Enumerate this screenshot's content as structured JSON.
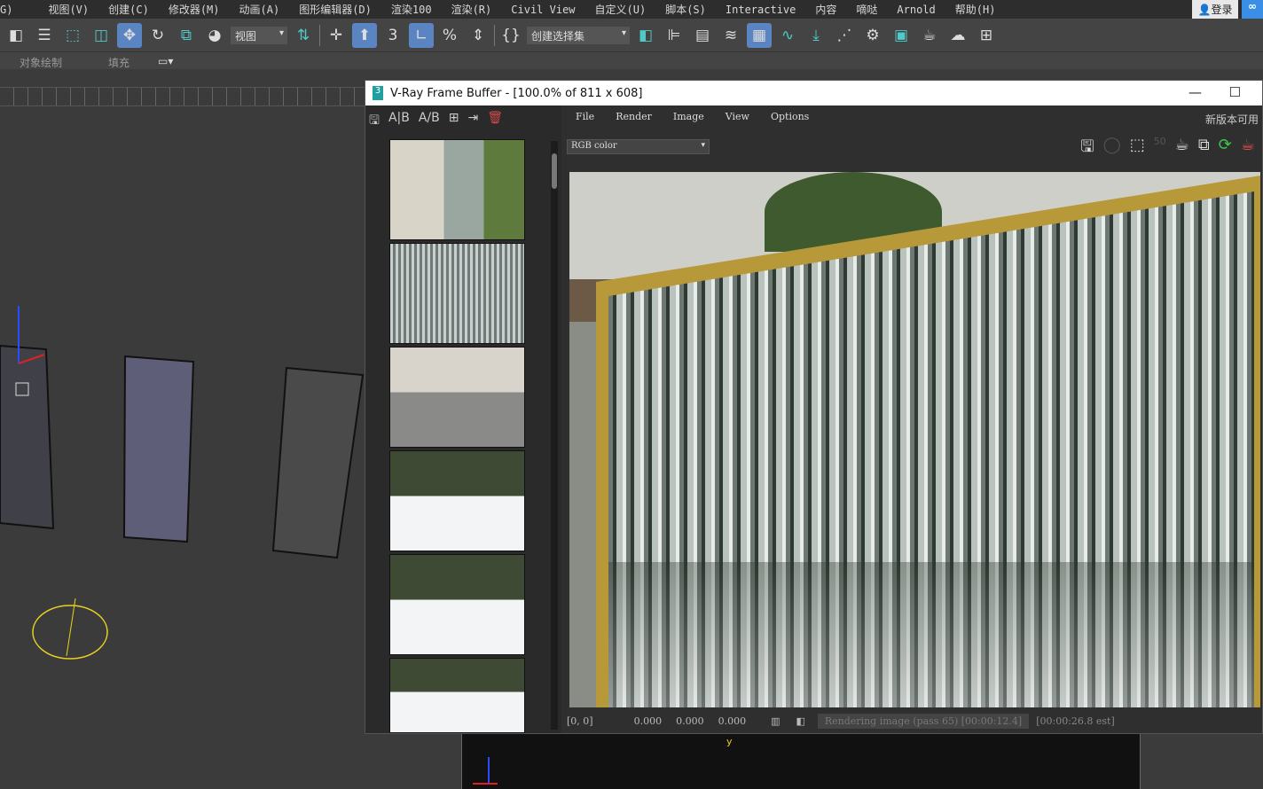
{
  "menu": {
    "items": [
      "G)",
      "视图(V)",
      "创建(C)",
      "修改器(M)",
      "动画(A)",
      "图形编辑器(D)",
      "渲染100",
      "渲染(R)",
      "Civil View",
      "自定义(U)",
      "脚本(S)",
      "Interactive",
      "内容",
      "嘀哒",
      "Arnold",
      "帮助(H)"
    ],
    "login": "登录"
  },
  "toolbar": {
    "view_dropdown": "视图",
    "selection_set": "创建选择集"
  },
  "ribbon": {
    "tab1": "对象绘制",
    "tab2": "填充"
  },
  "vfb": {
    "title": "V-Ray Frame Buffer - [100.0% of 811 x 608]",
    "menu": [
      "File",
      "Render",
      "Image",
      "View",
      "Options"
    ],
    "new_version": "新版本可用",
    "channel": "RGB color",
    "status": {
      "coords": "[0, 0]",
      "r": "0.000",
      "g": "0.000",
      "b": "0.000",
      "progress": "Rendering image (pass 65) [00:00:12.4]",
      "estimate": "[00:00:26.8 est]"
    }
  },
  "viewport": {
    "axis_y": "y"
  }
}
